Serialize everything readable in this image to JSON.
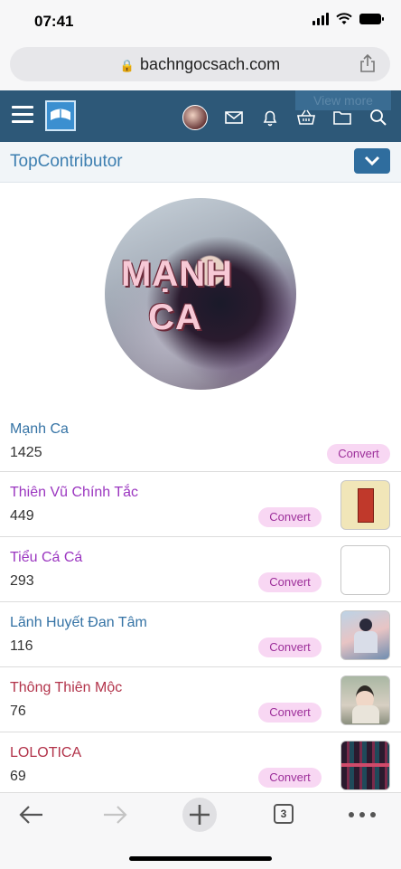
{
  "status_bar": {
    "time": "07:41"
  },
  "browser": {
    "url": "bachngocsach.com"
  },
  "site_header": {
    "ghost_button_label": "View more"
  },
  "section": {
    "title": "TopContributor"
  },
  "profile": {
    "avatar_text_line1": "MẠNH",
    "avatar_text_line2": "CA"
  },
  "contributors": [
    {
      "name": "Mạnh Ca",
      "count": "1425",
      "badge": "Convert",
      "name_color": "#3573a5"
    },
    {
      "name": "Thiên Vũ Chính Tắc",
      "count": "449",
      "badge": "Convert",
      "name_color": "#9b36c0"
    },
    {
      "name": "Tiểu Cá Cá",
      "count": "293",
      "badge": "Convert",
      "name_color": "#9b36c0"
    },
    {
      "name": "Lãnh Huyết Đan Tâm",
      "count": "116",
      "badge": "Convert",
      "name_color": "#3573a5"
    },
    {
      "name": "Thông Thiên Mộc",
      "count": "76",
      "badge": "Convert",
      "name_color": "#b2334a"
    },
    {
      "name": "LOLOTICA",
      "count": "69",
      "badge": "Convert",
      "name_color": "#b2334a"
    }
  ],
  "toolbar": {
    "tab_count": "3"
  }
}
